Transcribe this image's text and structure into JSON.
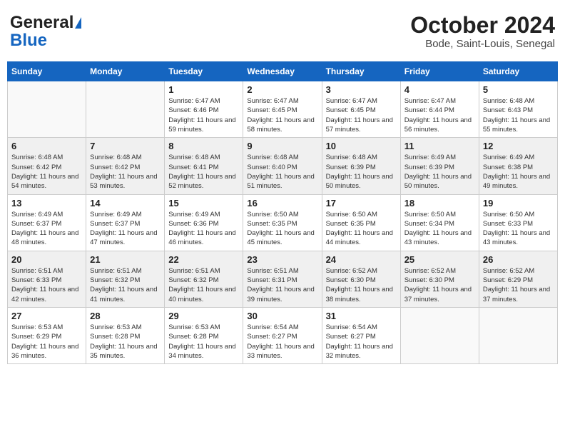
{
  "header": {
    "logo_line1": "General",
    "logo_line2": "Blue",
    "month": "October 2024",
    "location": "Bode, Saint-Louis, Senegal"
  },
  "weekdays": [
    "Sunday",
    "Monday",
    "Tuesday",
    "Wednesday",
    "Thursday",
    "Friday",
    "Saturday"
  ],
  "weeks": [
    [
      {
        "day": "",
        "info": ""
      },
      {
        "day": "",
        "info": ""
      },
      {
        "day": "1",
        "info": "Sunrise: 6:47 AM\nSunset: 6:46 PM\nDaylight: 11 hours and 59 minutes."
      },
      {
        "day": "2",
        "info": "Sunrise: 6:47 AM\nSunset: 6:45 PM\nDaylight: 11 hours and 58 minutes."
      },
      {
        "day": "3",
        "info": "Sunrise: 6:47 AM\nSunset: 6:45 PM\nDaylight: 11 hours and 57 minutes."
      },
      {
        "day": "4",
        "info": "Sunrise: 6:47 AM\nSunset: 6:44 PM\nDaylight: 11 hours and 56 minutes."
      },
      {
        "day": "5",
        "info": "Sunrise: 6:48 AM\nSunset: 6:43 PM\nDaylight: 11 hours and 55 minutes."
      }
    ],
    [
      {
        "day": "6",
        "info": "Sunrise: 6:48 AM\nSunset: 6:42 PM\nDaylight: 11 hours and 54 minutes."
      },
      {
        "day": "7",
        "info": "Sunrise: 6:48 AM\nSunset: 6:42 PM\nDaylight: 11 hours and 53 minutes."
      },
      {
        "day": "8",
        "info": "Sunrise: 6:48 AM\nSunset: 6:41 PM\nDaylight: 11 hours and 52 minutes."
      },
      {
        "day": "9",
        "info": "Sunrise: 6:48 AM\nSunset: 6:40 PM\nDaylight: 11 hours and 51 minutes."
      },
      {
        "day": "10",
        "info": "Sunrise: 6:48 AM\nSunset: 6:39 PM\nDaylight: 11 hours and 50 minutes."
      },
      {
        "day": "11",
        "info": "Sunrise: 6:49 AM\nSunset: 6:39 PM\nDaylight: 11 hours and 50 minutes."
      },
      {
        "day": "12",
        "info": "Sunrise: 6:49 AM\nSunset: 6:38 PM\nDaylight: 11 hours and 49 minutes."
      }
    ],
    [
      {
        "day": "13",
        "info": "Sunrise: 6:49 AM\nSunset: 6:37 PM\nDaylight: 11 hours and 48 minutes."
      },
      {
        "day": "14",
        "info": "Sunrise: 6:49 AM\nSunset: 6:37 PM\nDaylight: 11 hours and 47 minutes."
      },
      {
        "day": "15",
        "info": "Sunrise: 6:49 AM\nSunset: 6:36 PM\nDaylight: 11 hours and 46 minutes."
      },
      {
        "day": "16",
        "info": "Sunrise: 6:50 AM\nSunset: 6:35 PM\nDaylight: 11 hours and 45 minutes."
      },
      {
        "day": "17",
        "info": "Sunrise: 6:50 AM\nSunset: 6:35 PM\nDaylight: 11 hours and 44 minutes."
      },
      {
        "day": "18",
        "info": "Sunrise: 6:50 AM\nSunset: 6:34 PM\nDaylight: 11 hours and 43 minutes."
      },
      {
        "day": "19",
        "info": "Sunrise: 6:50 AM\nSunset: 6:33 PM\nDaylight: 11 hours and 43 minutes."
      }
    ],
    [
      {
        "day": "20",
        "info": "Sunrise: 6:51 AM\nSunset: 6:33 PM\nDaylight: 11 hours and 42 minutes."
      },
      {
        "day": "21",
        "info": "Sunrise: 6:51 AM\nSunset: 6:32 PM\nDaylight: 11 hours and 41 minutes."
      },
      {
        "day": "22",
        "info": "Sunrise: 6:51 AM\nSunset: 6:32 PM\nDaylight: 11 hours and 40 minutes."
      },
      {
        "day": "23",
        "info": "Sunrise: 6:51 AM\nSunset: 6:31 PM\nDaylight: 11 hours and 39 minutes."
      },
      {
        "day": "24",
        "info": "Sunrise: 6:52 AM\nSunset: 6:30 PM\nDaylight: 11 hours and 38 minutes."
      },
      {
        "day": "25",
        "info": "Sunrise: 6:52 AM\nSunset: 6:30 PM\nDaylight: 11 hours and 37 minutes."
      },
      {
        "day": "26",
        "info": "Sunrise: 6:52 AM\nSunset: 6:29 PM\nDaylight: 11 hours and 37 minutes."
      }
    ],
    [
      {
        "day": "27",
        "info": "Sunrise: 6:53 AM\nSunset: 6:29 PM\nDaylight: 11 hours and 36 minutes."
      },
      {
        "day": "28",
        "info": "Sunrise: 6:53 AM\nSunset: 6:28 PM\nDaylight: 11 hours and 35 minutes."
      },
      {
        "day": "29",
        "info": "Sunrise: 6:53 AM\nSunset: 6:28 PM\nDaylight: 11 hours and 34 minutes."
      },
      {
        "day": "30",
        "info": "Sunrise: 6:54 AM\nSunset: 6:27 PM\nDaylight: 11 hours and 33 minutes."
      },
      {
        "day": "31",
        "info": "Sunrise: 6:54 AM\nSunset: 6:27 PM\nDaylight: 11 hours and 32 minutes."
      },
      {
        "day": "",
        "info": ""
      },
      {
        "day": "",
        "info": ""
      }
    ]
  ]
}
